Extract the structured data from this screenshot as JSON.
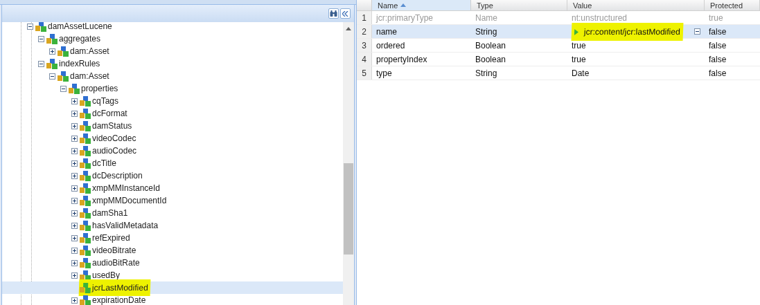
{
  "tree": [
    {
      "label": "damAssetLucene",
      "kind": "node",
      "expanded": true,
      "selected": false,
      "highlighted": false,
      "children": [
        {
          "label": "aggregates",
          "kind": "node",
          "expanded": true,
          "selected": false,
          "highlighted": false,
          "children": [
            {
              "label": "dam:Asset",
              "kind": "node",
              "expanded": false,
              "selected": false,
              "highlighted": false
            }
          ]
        },
        {
          "label": "indexRules",
          "kind": "node",
          "expanded": true,
          "selected": false,
          "highlighted": false,
          "children": [
            {
              "label": "dam:Asset",
              "kind": "node",
              "expanded": true,
              "selected": false,
              "highlighted": false,
              "children": [
                {
                  "label": "properties",
                  "kind": "node",
                  "expanded": true,
                  "selected": false,
                  "highlighted": false,
                  "children": [
                    {
                      "label": "cqTags",
                      "kind": "node",
                      "expanded": false,
                      "selected": false,
                      "highlighted": false
                    },
                    {
                      "label": "dcFormat",
                      "kind": "node",
                      "expanded": false,
                      "selected": false,
                      "highlighted": false
                    },
                    {
                      "label": "damStatus",
                      "kind": "node",
                      "expanded": false,
                      "selected": false,
                      "highlighted": false
                    },
                    {
                      "label": "videoCodec",
                      "kind": "node",
                      "expanded": false,
                      "selected": false,
                      "highlighted": false
                    },
                    {
                      "label": "audioCodec",
                      "kind": "node",
                      "expanded": false,
                      "selected": false,
                      "highlighted": false
                    },
                    {
                      "label": "dcTitle",
                      "kind": "node",
                      "expanded": false,
                      "selected": false,
                      "highlighted": false
                    },
                    {
                      "label": "dcDescription",
                      "kind": "node",
                      "expanded": false,
                      "selected": false,
                      "highlighted": false
                    },
                    {
                      "label": "xmpMMInstanceId",
                      "kind": "node",
                      "expanded": false,
                      "selected": false,
                      "highlighted": false
                    },
                    {
                      "label": "xmpMMDocumentId",
                      "kind": "node",
                      "expanded": false,
                      "selected": false,
                      "highlighted": false
                    },
                    {
                      "label": "damSha1",
                      "kind": "node",
                      "expanded": false,
                      "selected": false,
                      "highlighted": false
                    },
                    {
                      "label": "hasValidMetadata",
                      "kind": "node",
                      "expanded": false,
                      "selected": false,
                      "highlighted": false
                    },
                    {
                      "label": "refExpired",
                      "kind": "node",
                      "expanded": false,
                      "selected": false,
                      "highlighted": false
                    },
                    {
                      "label": "videoBitrate",
                      "kind": "node",
                      "expanded": false,
                      "selected": false,
                      "highlighted": false
                    },
                    {
                      "label": "audioBitRate",
                      "kind": "node",
                      "expanded": false,
                      "selected": false,
                      "highlighted": false
                    },
                    {
                      "label": "usedBy",
                      "kind": "node",
                      "expanded": false,
                      "selected": false,
                      "highlighted": false
                    },
                    {
                      "label": "jcrLastModified",
                      "kind": "leaf",
                      "selected": true,
                      "highlighted": true
                    },
                    {
                      "label": "expirationDate",
                      "kind": "node",
                      "expanded": false,
                      "selected": false,
                      "highlighted": false
                    }
                  ]
                }
              ]
            }
          ]
        }
      ]
    }
  ],
  "table": {
    "columns": [
      {
        "label": "Name",
        "sorted": true
      },
      {
        "label": "Type",
        "sorted": false
      },
      {
        "label": "Value",
        "sorted": false
      },
      {
        "label": "Protected",
        "sorted": false
      }
    ],
    "rows": [
      {
        "number": "1",
        "name": "jcr:primaryType",
        "type": "Name",
        "value": "nt:unstructured",
        "protected": "true",
        "kind": "single",
        "selected": false,
        "disabled": true,
        "highlighted": false
      },
      {
        "number": "2",
        "name": "name",
        "type": "String",
        "value": "jcr:content/jcr:lastModified",
        "protected": "false",
        "kind": "multi",
        "selected": true,
        "disabled": false,
        "highlighted": true
      },
      {
        "number": "3",
        "name": "ordered",
        "type": "Boolean",
        "value": "true",
        "protected": "false",
        "kind": "single",
        "selected": false,
        "disabled": false,
        "highlighted": false
      },
      {
        "number": "4",
        "name": "propertyIndex",
        "type": "Boolean",
        "value": "true",
        "protected": "false",
        "kind": "single",
        "selected": false,
        "disabled": false,
        "highlighted": false
      },
      {
        "number": "5",
        "name": "type",
        "type": "String",
        "value": "Date",
        "protected": "false",
        "kind": "single",
        "selected": false,
        "disabled": false,
        "highlighted": false
      }
    ]
  }
}
